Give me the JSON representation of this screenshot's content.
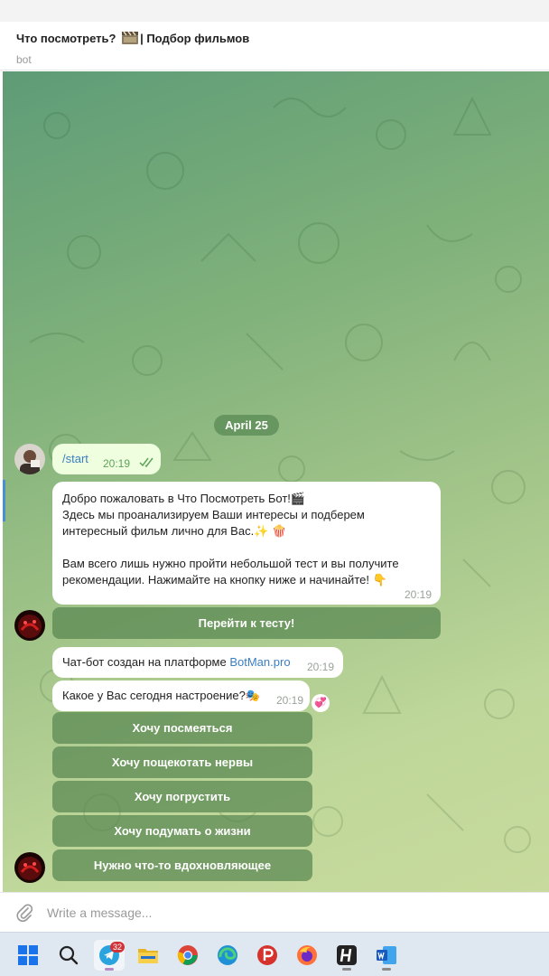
{
  "header": {
    "title_before": "Что посмотреть? ",
    "title_after": "| Подбор фильмов",
    "subtitle": "bot"
  },
  "chat": {
    "date_label": "April 25",
    "outgoing": {
      "text": "/start",
      "time": "20:19"
    },
    "welcome": {
      "text": "Добро пожаловать в Что Посмотреть Бот!🎬\nЗдесь мы проанализируем Ваши интересы и подберем интересный фильм лично для Вас.✨ 🍿\n\nВам всего лишь нужно пройти небольшой тест и вы получите рекомендации. Нажимайте на кнопку ниже и начинайте! 👇",
      "time": "20:19",
      "button": "Перейти к тесту!"
    },
    "platform": {
      "text_before": "Чат-бот создан на платформе ",
      "link": "BotMan.pro",
      "time": "20:19"
    },
    "question": {
      "text": "Какое у Вас сегодня настроение?🎭",
      "time": "20:19",
      "reaction": "💞",
      "options": [
        "Хочу посмеяться",
        "Хочу пощекотать нервы",
        "Хочу погрустить",
        "Хочу подумать о жизни",
        "Нужно что-то вдохновляющее"
      ]
    }
  },
  "composer": {
    "placeholder": "Write a message..."
  },
  "taskbar": {
    "telegram_badge": "32",
    "apps": [
      "windows-start",
      "search",
      "telegram",
      "file-explorer",
      "chrome",
      "edge",
      "pika",
      "firefox",
      "hide-app",
      "word"
    ]
  },
  "colors": {
    "chat_bg_from": "#5e9c77",
    "chat_bg_to": "#c8da9d",
    "bubble_in": "#ffffff",
    "bubble_out": "#eefedf",
    "keyboard_button": "#588750",
    "link": "#3a7fc1",
    "taskbar": "#dfe7f1"
  }
}
